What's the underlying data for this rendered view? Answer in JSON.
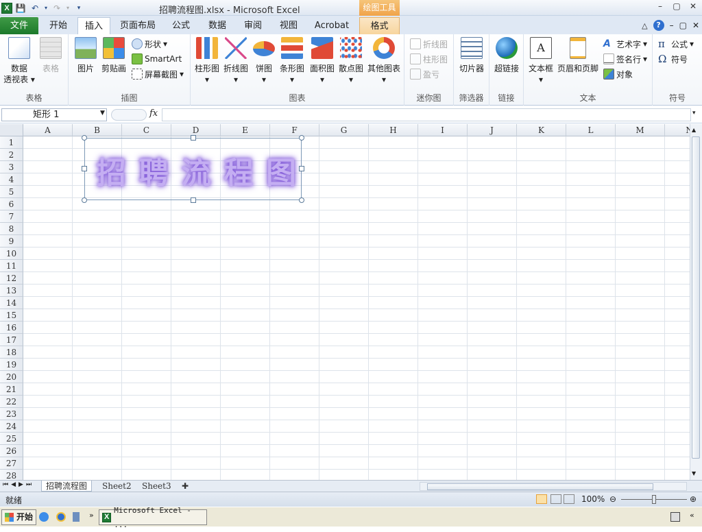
{
  "window": {
    "title": "招聘流程图.xlsx  -  Microsoft Excel",
    "context_tab_group": "绘图工具",
    "controls": [
      "–",
      "▢",
      "✕"
    ],
    "ribbon_controls": [
      "△",
      "?",
      "–",
      "▢",
      "✕"
    ]
  },
  "tabs": [
    "文件",
    "开始",
    "插入",
    "页面布局",
    "公式",
    "数据",
    "审阅",
    "视图",
    "Acrobat",
    "格式"
  ],
  "ribbon": {
    "groups": {
      "table": "表格",
      "illustrations": "插图",
      "charts": "图表",
      "sparklines": "迷你图",
      "filter": "筛选器",
      "links": "链接",
      "text": "文本",
      "symbols": "符号"
    },
    "buttons": {
      "pivot_line1": "数据",
      "pivot_line2": "透视表",
      "table": "表格",
      "picture": "图片",
      "clipart": "剪贴画",
      "shapes": "形状",
      "smartart": "SmartArt",
      "screenshot": "屏幕截图",
      "column": "柱形图",
      "line": "折线图",
      "pie": "饼图",
      "bar": "条形图",
      "area": "面积图",
      "scatter": "散点图",
      "other_charts": "其他图表",
      "spark_line": "折线图",
      "spark_column": "柱形图",
      "spark_winloss": "盈亏",
      "slicer": "切片器",
      "hyperlink": "超链接",
      "textbox": "文本框",
      "header_footer": "页眉和页脚",
      "wordart": "艺术字",
      "signature": "签名行",
      "object": "对象",
      "equation": "公式",
      "symbol": "符号"
    }
  },
  "formula_bar": {
    "name_box": "矩形 1",
    "fx": "fx",
    "value": ""
  },
  "columns": [
    "A",
    "B",
    "C",
    "D",
    "E",
    "F",
    "G",
    "H",
    "I",
    "J",
    "K",
    "L",
    "M",
    "N"
  ],
  "rows": [
    "1",
    "2",
    "3",
    "4",
    "5",
    "6",
    "7",
    "8",
    "9",
    "10",
    "11",
    "12",
    "13",
    "14",
    "15",
    "16",
    "17",
    "18",
    "19",
    "20",
    "21",
    "22",
    "23",
    "24",
    "25",
    "26",
    "27",
    "28"
  ],
  "shape": {
    "text": "招聘流程图",
    "text_color": "#c4aef2",
    "glow_color": "#7e54d8"
  },
  "sheet_tabs": [
    "招聘流程图",
    "Sheet2",
    "Sheet3"
  ],
  "status": {
    "ready": "就绪",
    "zoom": "100%"
  },
  "taskbar": {
    "start": "开始",
    "task": "Microsoft Excel - ..."
  },
  "colors": {
    "file_tab": "#1c7a2b",
    "context_tab": "#f0a34a",
    "accent": "#2f6fcf"
  }
}
